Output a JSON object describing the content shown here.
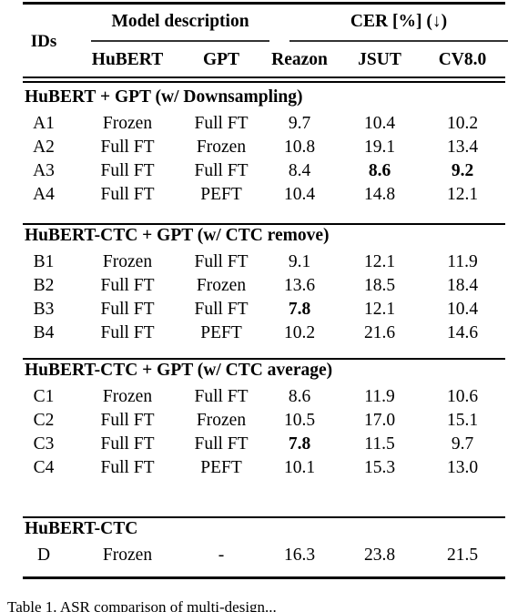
{
  "table": {
    "header": {
      "ids_label": "IDs",
      "group_model": "Model description",
      "group_cer": "CER [%] (↓)",
      "col_hubert": "HuBERT",
      "col_gpt": "GPT",
      "col_reazon": "Reazon",
      "col_jsut": "JSUT",
      "col_cv": "CV8.0"
    },
    "sections": [
      {
        "title": "HuBERT + GPT (w/ Downsampling)",
        "rows": [
          {
            "id": "A1",
            "hubert": "Frozen",
            "gpt": "Full FT",
            "reazon": "9.7",
            "jsut": "10.4",
            "cv": "10.2",
            "bold": {
              "reazon": false,
              "jsut": false,
              "cv": false
            }
          },
          {
            "id": "A2",
            "hubert": "Full FT",
            "gpt": "Frozen",
            "reazon": "10.8",
            "jsut": "19.1",
            "cv": "13.4",
            "bold": {
              "reazon": false,
              "jsut": false,
              "cv": false
            }
          },
          {
            "id": "A3",
            "hubert": "Full FT",
            "gpt": "Full FT",
            "reazon": "8.4",
            "jsut": "8.6",
            "cv": "9.2",
            "bold": {
              "reazon": false,
              "jsut": true,
              "cv": true
            }
          },
          {
            "id": "A4",
            "hubert": "Full FT",
            "gpt": "PEFT",
            "reazon": "10.4",
            "jsut": "14.8",
            "cv": "12.1",
            "bold": {
              "reazon": false,
              "jsut": false,
              "cv": false
            }
          }
        ]
      },
      {
        "title": "HuBERT-CTC + GPT (w/ CTC remove)",
        "rows": [
          {
            "id": "B1",
            "hubert": "Frozen",
            "gpt": "Full FT",
            "reazon": "9.1",
            "jsut": "12.1",
            "cv": "11.9",
            "bold": {
              "reazon": false,
              "jsut": false,
              "cv": false
            }
          },
          {
            "id": "B2",
            "hubert": "Full FT",
            "gpt": "Frozen",
            "reazon": "13.6",
            "jsut": "18.5",
            "cv": "18.4",
            "bold": {
              "reazon": false,
              "jsut": false,
              "cv": false
            }
          },
          {
            "id": "B3",
            "hubert": "Full FT",
            "gpt": "Full FT",
            "reazon": "7.8",
            "jsut": "12.1",
            "cv": "10.4",
            "bold": {
              "reazon": true,
              "jsut": false,
              "cv": false
            }
          },
          {
            "id": "B4",
            "hubert": "Full FT",
            "gpt": "PEFT",
            "reazon": "10.2",
            "jsut": "21.6",
            "cv": "14.6",
            "bold": {
              "reazon": false,
              "jsut": false,
              "cv": false
            }
          }
        ]
      },
      {
        "title": "HuBERT-CTC + GPT (w/ CTC average)",
        "rows": [
          {
            "id": "C1",
            "hubert": "Frozen",
            "gpt": "Full FT",
            "reazon": "8.6",
            "jsut": "11.9",
            "cv": "10.6",
            "bold": {
              "reazon": false,
              "jsut": false,
              "cv": false
            }
          },
          {
            "id": "C2",
            "hubert": "Full FT",
            "gpt": "Frozen",
            "reazon": "10.5",
            "jsut": "17.0",
            "cv": "15.1",
            "bold": {
              "reazon": false,
              "jsut": false,
              "cv": false
            }
          },
          {
            "id": "C3",
            "hubert": "Full FT",
            "gpt": "Full FT",
            "reazon": "7.8",
            "jsut": "11.5",
            "cv": "9.7",
            "bold": {
              "reazon": true,
              "jsut": false,
              "cv": false
            }
          },
          {
            "id": "C4",
            "hubert": "Full FT",
            "gpt": "PEFT",
            "reazon": "10.1",
            "jsut": "15.3",
            "cv": "13.0",
            "bold": {
              "reazon": false,
              "jsut": false,
              "cv": false
            }
          }
        ]
      },
      {
        "title": "HuBERT-CTC",
        "rows": [
          {
            "id": "D",
            "hubert": "Frozen",
            "gpt": "-",
            "reazon": "16.3",
            "jsut": "23.8",
            "cv": "21.5",
            "bold": {
              "reazon": false,
              "jsut": false,
              "cv": false
            }
          }
        ]
      }
    ]
  },
  "caption_sliver": "Table 1. ASR comparison of multi-design..."
}
